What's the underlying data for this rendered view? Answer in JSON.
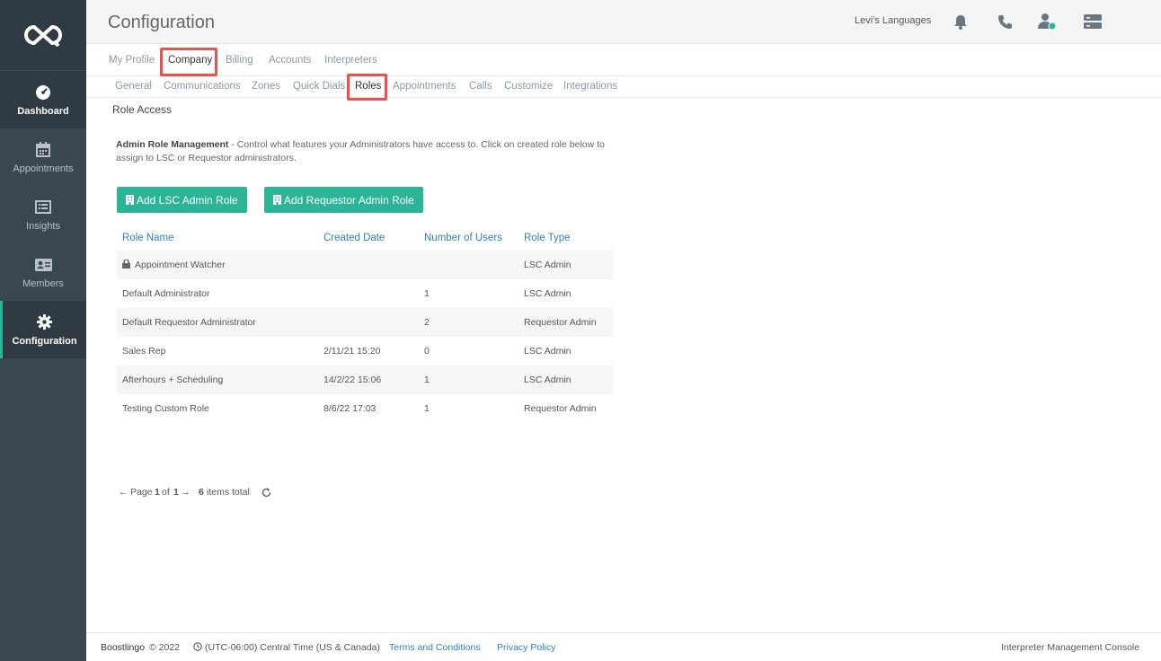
{
  "header": {
    "title": "Configuration",
    "company": "Levi's Languages"
  },
  "sidebar": {
    "items": [
      {
        "label": "Dashboard",
        "icon": "dashboard-gauge-icon"
      },
      {
        "label": "Appointments",
        "icon": "calendar-icon"
      },
      {
        "label": "Insights",
        "icon": "insights-list-icon"
      },
      {
        "label": "Members",
        "icon": "id-card-icon"
      },
      {
        "label": "Configuration",
        "icon": "gear-icon"
      }
    ]
  },
  "tabs_primary": [
    {
      "label": "My Profile"
    },
    {
      "label": "Company",
      "active": true
    },
    {
      "label": "Billing"
    },
    {
      "label": "Accounts"
    },
    {
      "label": "Interpreters"
    }
  ],
  "tabs_secondary": [
    {
      "label": "General"
    },
    {
      "label": "Communications"
    },
    {
      "label": "Zones"
    },
    {
      "label": "Quick Dials"
    },
    {
      "label": "Roles",
      "active": true
    },
    {
      "label": "Appointments"
    },
    {
      "label": "Calls"
    },
    {
      "label": "Customize"
    },
    {
      "label": "Integrations"
    }
  ],
  "content": {
    "section_title": "Role Access",
    "desc_bold": "Admin Role Management",
    "desc_text": " - Control what features your Administrators have access to. Click on created role below to assign to LSC or Requestor administrators.",
    "btn_lsc": "Add LSC Admin Role",
    "btn_requestor": "Add Requestor Admin Role"
  },
  "table": {
    "headers": [
      "Role Name",
      "Created Date",
      "Number of Users",
      "Role Type"
    ],
    "rows": [
      {
        "name": "Appointment Watcher",
        "date": "",
        "users": "",
        "type": "LSC Admin",
        "locked": true
      },
      {
        "name": "Default Administrator",
        "date": "",
        "users": "1",
        "type": "LSC Admin"
      },
      {
        "name": "Default Requestor Administrator",
        "date": "",
        "users": "2",
        "type": "Requestor Admin"
      },
      {
        "name": "Sales Rep",
        "date": "2/11/21 15:20",
        "users": "0",
        "type": "LSC Admin"
      },
      {
        "name": "Afterhours + Scheduling",
        "date": "14/2/22 15:06",
        "users": "1",
        "type": "LSC Admin"
      },
      {
        "name": "Testing Custom Role",
        "date": "8/6/22 17:03",
        "users": "1",
        "type": "Requestor Admin"
      }
    ]
  },
  "pager": {
    "page_word": "Page",
    "page": "1",
    "of_word": "of",
    "total_pages": "1",
    "count": "6",
    "items_total": "items total"
  },
  "footer": {
    "brand": "Boostlingo",
    "copyright": "© 2022",
    "timezone": "(UTC-06:00) Central Time (US & Canada)",
    "terms": "Terms and Conditions",
    "privacy": "Privacy Policy",
    "console": "Interpreter Management Console"
  },
  "colors": {
    "accent": "#2bb596",
    "link": "#2f7fc1",
    "sidebar": "#3a4650",
    "highlight": "#e8534a"
  }
}
